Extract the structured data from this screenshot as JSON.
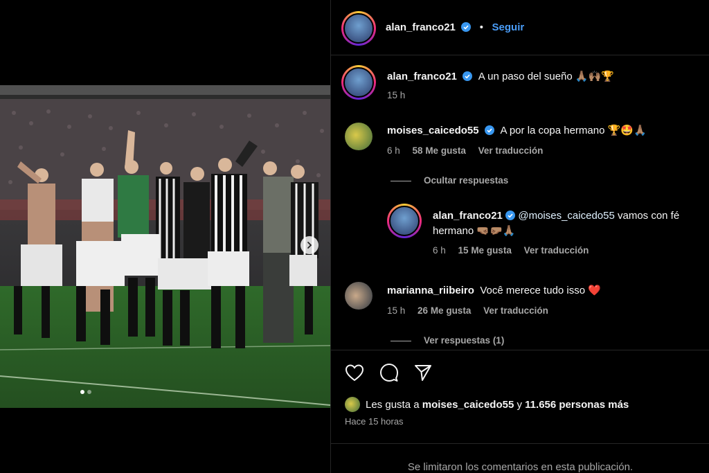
{
  "post": {
    "author": "alan_franco21",
    "follow_label": "Seguir",
    "separator": "•",
    "image_alt_description": "",
    "carousel_index": 1,
    "carousel_count": 2
  },
  "caption": {
    "author": "alan_franco21",
    "text": "A un paso del sueño 🙏🏽🙌🏽🏆",
    "time": "15 h"
  },
  "comments": [
    {
      "author": "moises_caicedo55",
      "verified": true,
      "text": "A por la copa hermano 🏆🤩🙏🏽",
      "time": "6 h",
      "likes": "58 Me gusta",
      "translate": "Ver traducción",
      "replies_toggle": "Ocultar respuestas"
    },
    {
      "author": "alan_franco21",
      "verified": true,
      "mention": "@moises_caicedo55",
      "text": " vamos con fé hermano 🤜🏽🤛🏽🙏🏽",
      "time": "6 h",
      "likes": "15 Me gusta",
      "translate": "Ver traducción"
    },
    {
      "author": "marianna_riibeiro",
      "verified": false,
      "text": "Você merece tudo isso ❤️",
      "time": "15 h",
      "likes": "26 Me gusta",
      "translate": "Ver traducción",
      "replies_toggle": "Ver respuestas (1)"
    }
  ],
  "likes_summary": {
    "prefix": "Les gusta a ",
    "user": "moises_caicedo55",
    "middle": " y ",
    "others": "11.656 personas más",
    "posted": "Hace 15 horas"
  },
  "footer": {
    "limited_comments": "Se limitaron los comentarios en esta publicación."
  },
  "colors": {
    "background": "#000000",
    "link_blue": "#4a9df8",
    "verified_blue": "#3897f0",
    "muted_text": "#a8a8a8",
    "divider": "#262626"
  }
}
